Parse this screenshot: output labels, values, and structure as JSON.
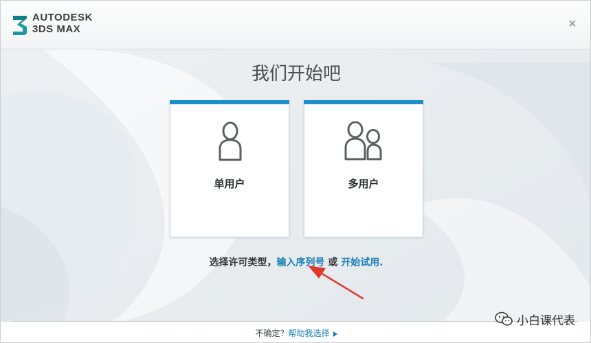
{
  "window": {
    "brand_line1": "AUTODESK",
    "brand_line2": "3DS MAX",
    "close_glyph": "✕"
  },
  "main": {
    "title": "我们开始吧",
    "cards": [
      {
        "label": "单用户",
        "icon": "single-user-icon"
      },
      {
        "label": "多用户",
        "icon": "multi-user-icon"
      }
    ],
    "instruction": {
      "prefix": "选择许可类型，",
      "serial_link": "输入序列号",
      "or_text": " 或 ",
      "trial_link": "开始试用",
      "suffix": "."
    }
  },
  "footer": {
    "question": "不确定？",
    "help_link": "帮助我选择"
  },
  "watermark": {
    "text": "小白课代表"
  },
  "colors": {
    "accent": "#1f8fcb",
    "link": "#1a7fb8",
    "annotation_arrow": "#e0392b"
  }
}
